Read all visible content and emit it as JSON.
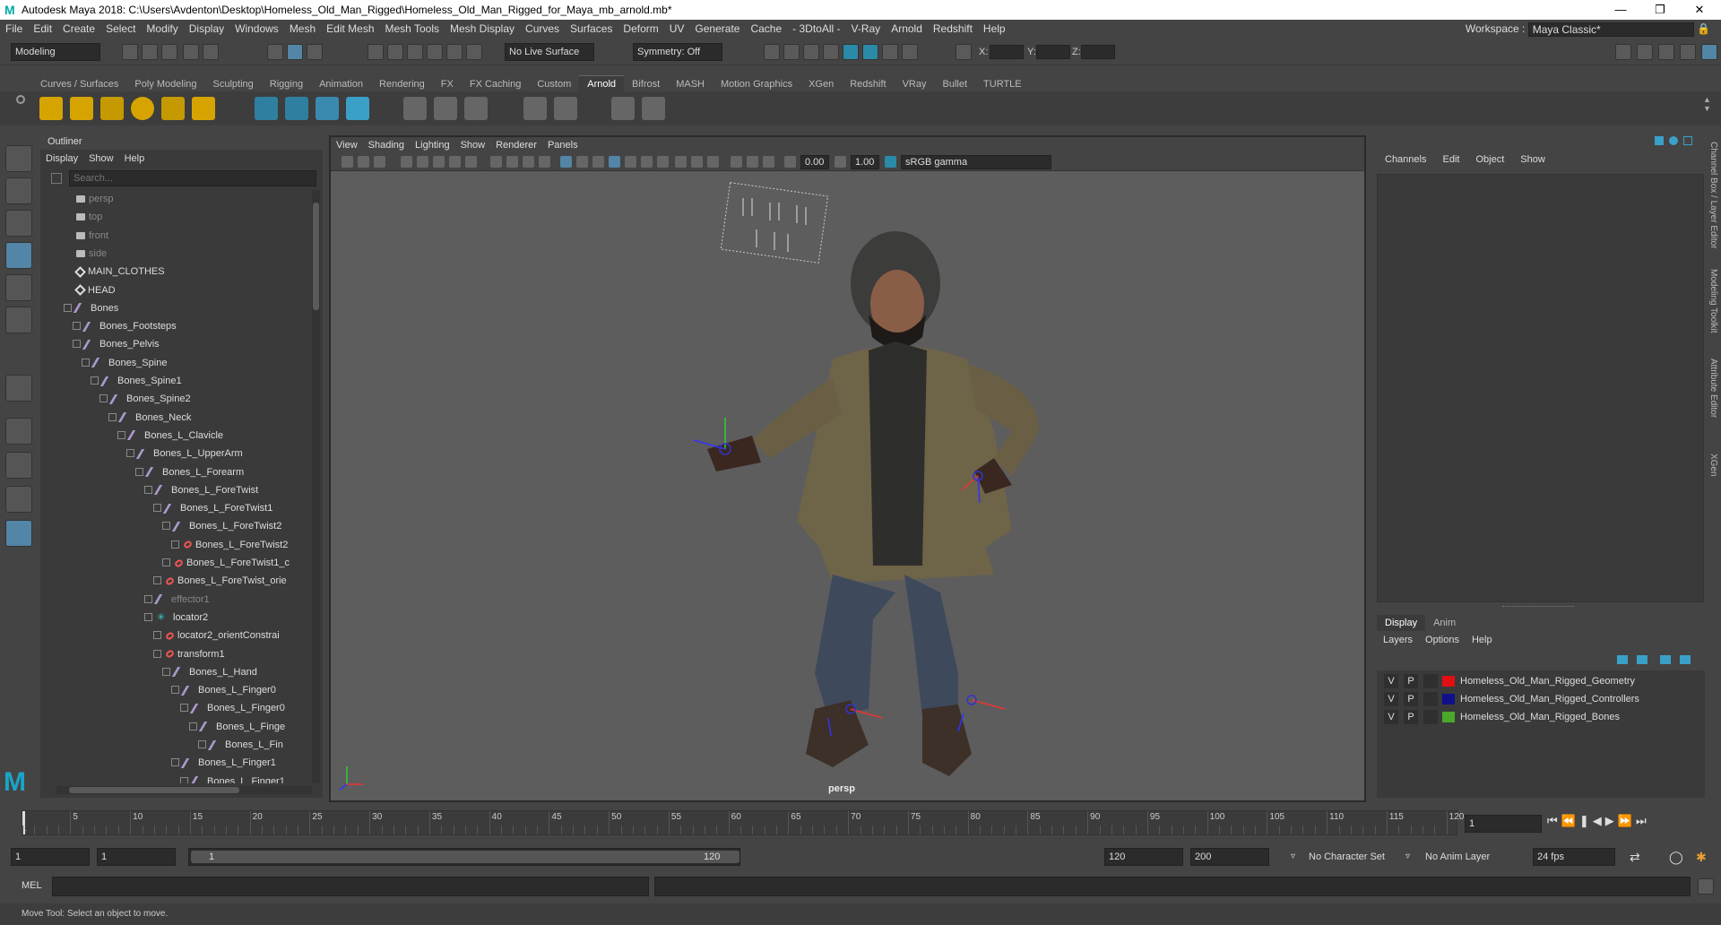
{
  "window": {
    "title": "Autodesk Maya 2018: C:\\Users\\Avdenton\\Desktop\\Homeless_Old_Man_Rigged\\Homeless_Old_Man_Rigged_for_Maya_mb_arnold.mb*",
    "logo": "M"
  },
  "menubar": [
    "File",
    "Edit",
    "Create",
    "Select",
    "Modify",
    "Display",
    "Windows",
    "Mesh",
    "Edit Mesh",
    "Mesh Tools",
    "Mesh Display",
    "Curves",
    "Surfaces",
    "Deform",
    "UV",
    "Generate",
    "Cache",
    "- 3DtoAll -",
    "V-Ray",
    "Arnold",
    "Redshift",
    "Help"
  ],
  "workspace": {
    "label": "Workspace :",
    "value": "Maya Classic*"
  },
  "statusline": {
    "mode": "Modeling",
    "live_surface": "No Live Surface",
    "symmetry": "Symmetry: Off",
    "x_label": "X:",
    "y_label": "Y:",
    "z_label": "Z:"
  },
  "shelf_tabs": [
    "Curves / Surfaces",
    "Poly Modeling",
    "Sculpting",
    "Rigging",
    "Animation",
    "Rendering",
    "FX",
    "FX Caching",
    "Custom",
    "Arnold",
    "Bifrost",
    "MASH",
    "Motion Graphics",
    "XGen",
    "Redshift",
    "VRay",
    "Bullet",
    "TURTLE"
  ],
  "shelf_active": "Arnold",
  "outliner": {
    "title": "Outliner",
    "menu": [
      "Display",
      "Show",
      "Help"
    ],
    "search_placeholder": "Search...",
    "items": [
      {
        "label": "persp",
        "icon": "camera-icon",
        "depth": 0
      },
      {
        "label": "top",
        "icon": "camera-icon",
        "depth": 0
      },
      {
        "label": "front",
        "icon": "camera-icon",
        "depth": 0
      },
      {
        "label": "side",
        "icon": "camera-icon",
        "depth": 0
      },
      {
        "label": "MAIN_CLOTHES",
        "icon": "group-icon",
        "depth": 0
      },
      {
        "label": "HEAD",
        "icon": "group-icon",
        "depth": 0
      },
      {
        "label": "Bones",
        "icon": "joint-icon",
        "depth": 0
      },
      {
        "label": "Bones_Footsteps",
        "icon": "joint-icon",
        "depth": 1
      },
      {
        "label": "Bones_Pelvis",
        "icon": "joint-icon",
        "depth": 1
      },
      {
        "label": "Bones_Spine",
        "icon": "joint-icon",
        "depth": 2
      },
      {
        "label": "Bones_Spine1",
        "icon": "joint-icon",
        "depth": 3
      },
      {
        "label": "Bones_Spine2",
        "icon": "joint-icon",
        "depth": 4
      },
      {
        "label": "Bones_Neck",
        "icon": "joint-icon",
        "depth": 5
      },
      {
        "label": "Bones_L_Clavicle",
        "icon": "joint-icon",
        "depth": 6
      },
      {
        "label": "Bones_L_UpperArm",
        "icon": "joint-icon",
        "depth": 7
      },
      {
        "label": "Bones_L_Forearm",
        "icon": "joint-icon",
        "depth": 8
      },
      {
        "label": "Bones_L_ForeTwist",
        "icon": "joint-icon",
        "depth": 9
      },
      {
        "label": "Bones_L_ForeTwist1",
        "icon": "joint-icon",
        "depth": 10
      },
      {
        "label": "Bones_L_ForeTwist2",
        "icon": "joint-icon",
        "depth": 11
      },
      {
        "label": "Bones_L_ForeTwist2",
        "icon": "constraint-icon",
        "depth": 12
      },
      {
        "label": "Bones_L_ForeTwist1_c",
        "icon": "constraint-icon",
        "depth": 11
      },
      {
        "label": "Bones_L_ForeTwist_orie",
        "icon": "constraint-icon",
        "depth": 10
      },
      {
        "label": "effector1",
        "icon": "joint-icon",
        "depth": 9
      },
      {
        "label": "locator2",
        "icon": "locator-icon",
        "depth": 9
      },
      {
        "label": "locator2_orientConstrai",
        "icon": "constraint-icon",
        "depth": 10
      },
      {
        "label": "transform1",
        "icon": "transform-icon",
        "depth": 10
      },
      {
        "label": "Bones_L_Hand",
        "icon": "joint-icon",
        "depth": 11
      },
      {
        "label": "Bones_L_Finger0",
        "icon": "joint-icon",
        "depth": 12
      },
      {
        "label": "Bones_L_Finger0",
        "icon": "joint-icon",
        "depth": 13
      },
      {
        "label": "Bones_L_Finge",
        "icon": "joint-icon",
        "depth": 14
      },
      {
        "label": "Bones_L_Fin",
        "icon": "joint-icon",
        "depth": 15
      },
      {
        "label": "Bones_L_Finger1",
        "icon": "joint-icon",
        "depth": 12
      },
      {
        "label": "Bones_L_Finger1",
        "icon": "joint-icon",
        "depth": 13
      }
    ]
  },
  "viewport": {
    "menu": [
      "View",
      "Shading",
      "Lighting",
      "Show",
      "Renderer",
      "Panels"
    ],
    "exposure": "0.00",
    "gamma": "1.00",
    "colorspace": "sRGB gamma",
    "camera": "persp"
  },
  "channel_box": {
    "menu": [
      "Channels",
      "Edit",
      "Object",
      "Show"
    ],
    "layer_tabs": [
      "Display",
      "Anim"
    ],
    "layer_active": "Display",
    "layer_menu": [
      "Layers",
      "Options",
      "Help"
    ],
    "layers": [
      {
        "v": "V",
        "p": "P",
        "color": "#e01010",
        "name": "Homeless_Old_Man_Rigged_Geometry"
      },
      {
        "v": "V",
        "p": "P",
        "color": "#10108a",
        "name": "Homeless_Old_Man_Rigged_Controllers"
      },
      {
        "v": "V",
        "p": "P",
        "color": "#4aa82a",
        "name": "Homeless_Old_Man_Rigged_Bones"
      }
    ]
  },
  "side_tabs": [
    "Channel Box / Layer Editor",
    "Modeling Toolkit",
    "Attribute Editor",
    "XGen"
  ],
  "timeline": {
    "ticks": [
      "5",
      "10",
      "15",
      "20",
      "25",
      "30",
      "35",
      "40",
      "45",
      "50",
      "55",
      "60",
      "65",
      "70",
      "75",
      "80",
      "85",
      "90",
      "95",
      "100",
      "105",
      "110",
      "115",
      "120"
    ],
    "first_tick": "1",
    "current_frame": "1"
  },
  "range": {
    "start": "1",
    "playback_start": "1",
    "slider_start": "1",
    "slider_end": "120",
    "playback_end": "120",
    "end": "200",
    "character_set": "No Character Set",
    "anim_layer": "No Anim Layer",
    "fps": "24 fps"
  },
  "command": {
    "label": "MEL"
  },
  "help_line": "Move Tool: Select an object to move."
}
